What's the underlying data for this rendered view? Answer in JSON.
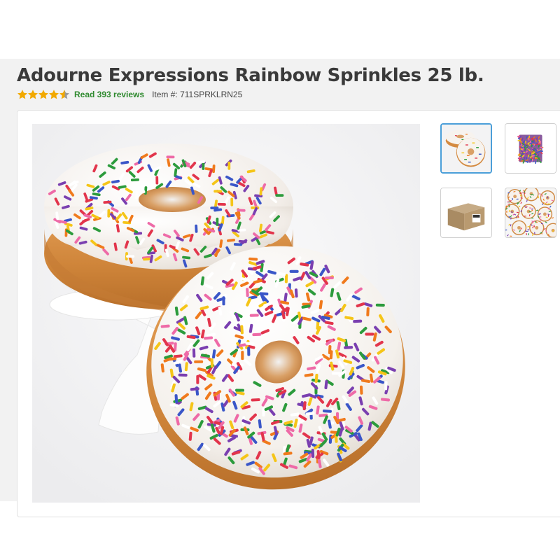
{
  "product": {
    "title": "Adourne Expressions Rainbow Sprinkles 25 lb.",
    "rating_stars": 4.5,
    "reviews_link": "Read 393 reviews",
    "item_number": "Item #: 711SPRKLRN25"
  },
  "colors": {
    "star": "#f2a900",
    "link": "#2f8a2f",
    "active_thumb_border": "#4b9fd9"
  },
  "gallery": {
    "main_image": "glazed-donuts-with-rainbow-sprinkles",
    "thumbnails": [
      {
        "image": "donuts-with-sprinkles",
        "selected": true
      },
      {
        "image": "bag-of-rainbow-sprinkles",
        "selected": false
      },
      {
        "image": "shipping-case-box",
        "selected": false
      },
      {
        "image": "tray-of-sprinkled-donuts",
        "selected": false
      }
    ]
  }
}
